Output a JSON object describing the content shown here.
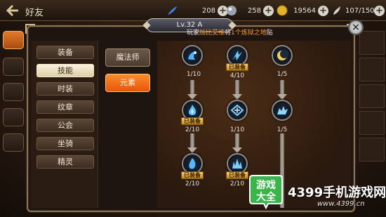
{
  "topbar": {
    "title": "好友",
    "currencies": [
      {
        "icon": "feather-icon",
        "value": "208"
      },
      {
        "icon": "gem-icon",
        "value": "258"
      },
      {
        "icon": "gold-coin-icon",
        "value": "19564"
      },
      {
        "icon": "stamina-icon",
        "value": "107/150"
      }
    ]
  },
  "header": {
    "level": "Lv.32 A",
    "notice_part1": "玩家",
    "notice_name": "加比艾维",
    "notice_part2": "将",
    "notice_highlight": "1个炼狱之地",
    "notice_tail": "贴"
  },
  "menu": {
    "items": [
      "装备",
      "技能",
      "时装",
      "纹章",
      "公会",
      "坐骑",
      "精灵"
    ],
    "active": "技能"
  },
  "submenu": {
    "items": [
      "魔法师",
      "元素"
    ],
    "active": "元素"
  },
  "skills": {
    "equipped_label": "已装备",
    "nodes": [
      {
        "level": "1/10",
        "equipped": false,
        "icon": "frost-skill-icon"
      },
      {
        "level": "4/10",
        "equipped": true,
        "icon": "ice-shard-skill-icon"
      },
      {
        "level": "1/5",
        "equipped": false,
        "icon": "moon-skill-icon"
      },
      {
        "level": "2/10",
        "equipped": true,
        "icon": "ice-flame-skill-icon"
      },
      {
        "level": "1/10",
        "equipped": false,
        "icon": "ice-crystal-skill-icon"
      },
      {
        "level": "1/5",
        "equipped": false,
        "icon": "ice-wolf-skill-icon"
      },
      {
        "level": "2/10",
        "equipped": true,
        "icon": "blizzard-skill-icon"
      },
      {
        "level": "2/10",
        "equipped": true,
        "icon": "ice-wall-skill-icon"
      }
    ]
  },
  "watermark": {
    "logo_line1": "游戏",
    "logo_line2": "大全",
    "site": "4399手机游戏网",
    "url": "www.4399.cn"
  },
  "colors": {
    "accent_orange": "#e5560b",
    "notice_orange": "#ff9a2e",
    "equip_gold": "#f5d070",
    "watermark_green": "#39b54a"
  }
}
